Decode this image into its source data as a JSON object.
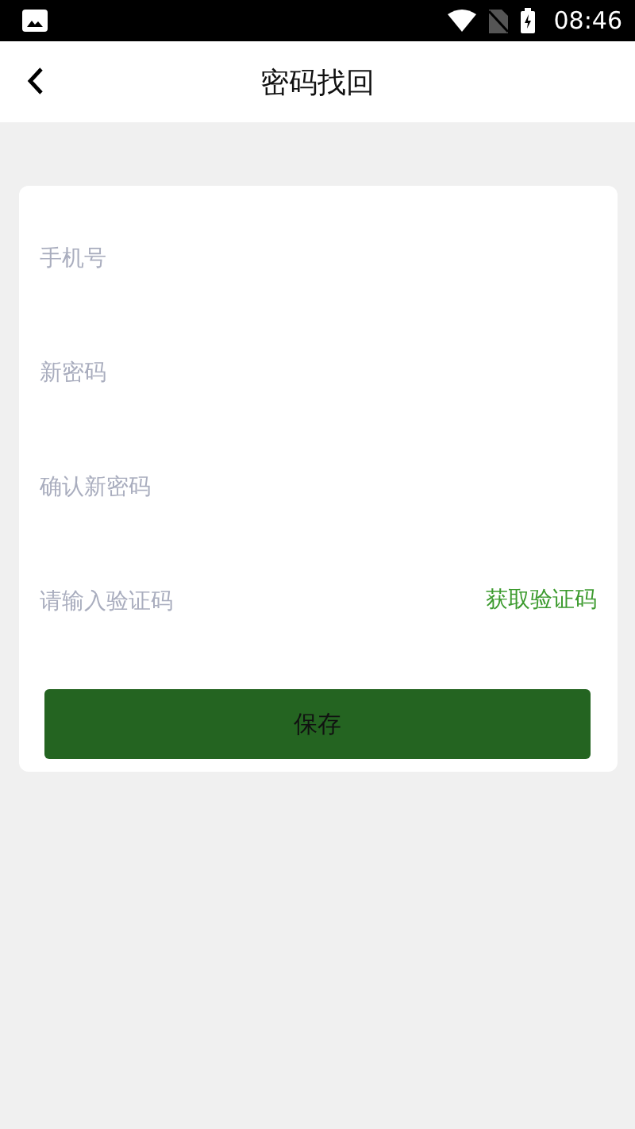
{
  "status_bar": {
    "time": "08:46"
  },
  "header": {
    "title": "密码找回"
  },
  "form": {
    "fields": [
      {
        "placeholder": "手机号"
      },
      {
        "placeholder": "新密码"
      },
      {
        "placeholder": "确认新密码"
      },
      {
        "placeholder": "请输入验证码",
        "action": "获取验证码"
      }
    ],
    "submit": "保存"
  }
}
